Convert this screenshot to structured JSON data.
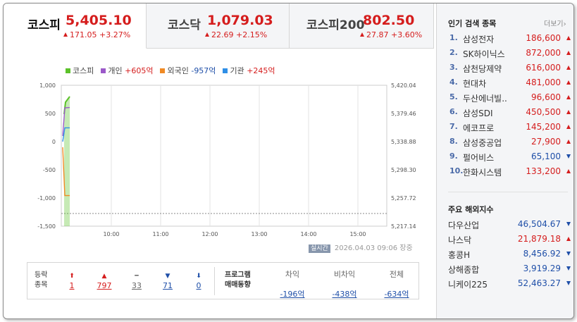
{
  "tabs": [
    {
      "name": "코스피",
      "price": "5,405.10",
      "change": "171.05 +3.27%"
    },
    {
      "name": "코스닥",
      "price": "1,079.03",
      "change": "22.69 +2.15%"
    },
    {
      "name": "코스피200",
      "price": "802.50",
      "change": "27.87 +3.60%"
    }
  ],
  "legend": {
    "kospi": "코스피",
    "individual_label": "개인",
    "individual_value": "+605억",
    "foreign_label": "외국인",
    "foreign_value": "-957억",
    "institution_label": "기관",
    "institution_value": "+245억"
  },
  "chart_data": {
    "type": "line",
    "y_left_ticks": [
      "1,000",
      "500",
      "0",
      "-500",
      "-1,000",
      "-1,500"
    ],
    "y_right_ticks": [
      "5,420.04",
      "5,379.46",
      "5,338.88",
      "5,298.30",
      "5,257.72",
      "5,217.14"
    ],
    "x_ticks": [
      "10:00",
      "11:00",
      "12:00",
      "13:00",
      "14:00",
      "15:00"
    ],
    "ylim_left": [
      -1500,
      1000
    ],
    "series": [
      {
        "name": "개인",
        "values": [
          100,
          600,
          605
        ]
      },
      {
        "name": "외국인",
        "values": [
          -100,
          -957,
          -957
        ]
      },
      {
        "name": "기관",
        "values": [
          0,
          245,
          245
        ]
      }
    ],
    "colors": {
      "kospi": "#5cc22a",
      "individual": "#9b59c9",
      "foreign": "#f08a24",
      "institution": "#2f8fe6"
    }
  },
  "timestamp": {
    "live": "실시간",
    "text": "2026.04.03 09:06  장중"
  },
  "stats": {
    "label_top": "등락",
    "label_bottom": "종목",
    "counts": [
      {
        "value": "1",
        "color": "red",
        "icon": "upper-limit-arrow"
      },
      {
        "value": "797",
        "color": "red",
        "icon": "up-triangle"
      },
      {
        "value": "33",
        "color": "gray",
        "icon": "flat-dash"
      },
      {
        "value": "71",
        "color": "blue",
        "icon": "down-triangle"
      },
      {
        "value": "0",
        "color": "blue",
        "icon": "lower-limit-arrow"
      }
    ],
    "program_label_top": "프로그램",
    "program_label_bottom": "매매동향",
    "program": [
      {
        "header": "차익",
        "value": "-196억"
      },
      {
        "header": "비차익",
        "value": "-438억"
      },
      {
        "header": "전체",
        "value": "-634억"
      }
    ]
  },
  "popular": {
    "title": "인기 검색 종목",
    "more": "더보기",
    "items": [
      {
        "rank": "1.",
        "name": "삼성전자",
        "price": "186,600",
        "dir": "up"
      },
      {
        "rank": "2.",
        "name": "SK하이닉스",
        "price": "872,000",
        "dir": "up"
      },
      {
        "rank": "3.",
        "name": "삼천당제약",
        "price": "616,000",
        "dir": "up"
      },
      {
        "rank": "4.",
        "name": "현대차",
        "price": "481,000",
        "dir": "up"
      },
      {
        "rank": "5.",
        "name": "두산에너빌..",
        "price": "96,600",
        "dir": "up"
      },
      {
        "rank": "6.",
        "name": "삼성SDI",
        "price": "450,500",
        "dir": "up"
      },
      {
        "rank": "7.",
        "name": "에코프로",
        "price": "145,200",
        "dir": "up"
      },
      {
        "rank": "8.",
        "name": "삼성중공업",
        "price": "27,900",
        "dir": "up"
      },
      {
        "rank": "9.",
        "name": "펄어비스",
        "price": "65,100",
        "dir": "down"
      },
      {
        "rank": "10.",
        "name": "한화시스템",
        "price": "133,200",
        "dir": "up"
      }
    ]
  },
  "world": {
    "title": "주요 해외지수",
    "items": [
      {
        "name": "다우산업",
        "price": "46,504.67",
        "dir": "down"
      },
      {
        "name": "나스닥",
        "price": "21,879.18",
        "dir": "up"
      },
      {
        "name": "홍콩H",
        "price": "8,456.92",
        "dir": "down"
      },
      {
        "name": "상해종합",
        "price": "3,919.29",
        "dir": "down"
      },
      {
        "name": "니케이225",
        "price": "52,463.27",
        "dir": "down"
      }
    ]
  }
}
